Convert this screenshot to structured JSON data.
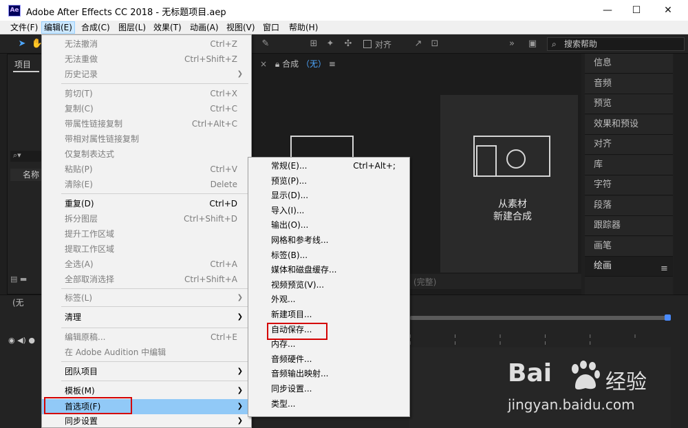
{
  "window": {
    "logo": "Ae",
    "title": "Adobe After Effects CC 2018 - 无标题项目.aep",
    "minimize": "—",
    "maximize": "☐",
    "close": "✕"
  },
  "menubar": [
    {
      "label": "文件(F)"
    },
    {
      "label": "编辑(E)",
      "active": true
    },
    {
      "label": "合成(C)"
    },
    {
      "label": "图层(L)"
    },
    {
      "label": "效果(T)"
    },
    {
      "label": "动画(A)"
    },
    {
      "label": "视图(V)"
    },
    {
      "label": "窗口"
    },
    {
      "label": "帮助(H)"
    }
  ],
  "toolbar": {
    "align_label": "对齐",
    "search_placeholder": "搜索帮助"
  },
  "project_panel": {
    "tab": "项目",
    "search_icon": "⌕▾",
    "name_col": "名称"
  },
  "viewer": {
    "tab_close": "×",
    "lock_icon": "lock-icon",
    "tab_label": "合成",
    "tab_value": "（无）",
    "menu_icon": "≡",
    "new_comp_line1": "从素材",
    "new_comp_line2": "新建合成",
    "resolution": "(完整)"
  },
  "right_panel": {
    "items": [
      "信息",
      "音频",
      "预览",
      "效果和预设",
      "对齐",
      "库",
      "字符",
      "段落",
      "跟踪器",
      "画笔",
      "绘画"
    ],
    "selected": "绘画",
    "menu_icon": "≡"
  },
  "timeline": {
    "tab": "(无",
    "ticks": "ı ı ı ı ı ı ı ı ı ı ı"
  },
  "edit_menu": {
    "items": [
      {
        "label": "无法撤消",
        "shortcut": "Ctrl+Z",
        "disabled": true
      },
      {
        "label": "无法重做",
        "shortcut": "Ctrl+Shift+Z",
        "disabled": true
      },
      {
        "label": "历史记录",
        "submenu": true,
        "disabled": true
      },
      {
        "label": "剪切(T)",
        "shortcut": "Ctrl+X",
        "disabled": true
      },
      {
        "label": "复制(C)",
        "shortcut": "Ctrl+C",
        "disabled": true
      },
      {
        "label": "带属性链接复制",
        "shortcut": "Ctrl+Alt+C",
        "disabled": true
      },
      {
        "label": "带相对属性链接复制",
        "disabled": true
      },
      {
        "label": "仅复制表达式",
        "disabled": true
      },
      {
        "label": "粘贴(P)",
        "shortcut": "Ctrl+V",
        "disabled": true
      },
      {
        "label": "清除(E)",
        "shortcut": "Delete",
        "disabled": true
      },
      {
        "label": "重复(D)",
        "shortcut": "Ctrl+D",
        "disabled": false
      },
      {
        "label": "拆分图层",
        "shortcut": "Ctrl+Shift+D",
        "disabled": true
      },
      {
        "label": "提升工作区域",
        "disabled": true
      },
      {
        "label": "提取工作区域",
        "disabled": true
      },
      {
        "label": "全选(A)",
        "shortcut": "Ctrl+A",
        "disabled": true
      },
      {
        "label": "全部取消选择",
        "shortcut": "Ctrl+Shift+A",
        "disabled": true
      },
      {
        "label": "标签(L)",
        "submenu": true,
        "disabled": true
      },
      {
        "label": "清理",
        "submenu": true,
        "disabled": false
      },
      {
        "label": "编辑原稿...",
        "shortcut": "Ctrl+E",
        "disabled": true
      },
      {
        "label": "在 Adobe Audition 中编辑",
        "disabled": true
      },
      {
        "label": "团队项目",
        "submenu": true,
        "disabled": false
      },
      {
        "label": "模板(M)",
        "submenu": true,
        "disabled": false
      },
      {
        "label": "首选项(F)",
        "submenu": true,
        "disabled": false,
        "highlighted": true
      },
      {
        "label": "同步设置",
        "submenu": true,
        "disabled": false
      }
    ]
  },
  "prefs_submenu": {
    "items": [
      {
        "label": "常规(E)...",
        "shortcut": "Ctrl+Alt+;"
      },
      {
        "label": "预览(P)..."
      },
      {
        "label": "显示(D)..."
      },
      {
        "label": "导入(I)..."
      },
      {
        "label": "输出(O)..."
      },
      {
        "label": "网格和参考线..."
      },
      {
        "label": "标签(B)..."
      },
      {
        "label": "媒体和磁盘缓存..."
      },
      {
        "label": "视频预览(V)..."
      },
      {
        "label": "外观..."
      },
      {
        "label": "新建项目..."
      },
      {
        "label": "自动保存...",
        "boxed": true
      },
      {
        "label": "内存..."
      },
      {
        "label": "音频硬件..."
      },
      {
        "label": "音频输出映射..."
      },
      {
        "label": "同步设置..."
      },
      {
        "label": "类型..."
      }
    ]
  },
  "watermark": {
    "logo": "Bai",
    "logo_cn": "经验",
    "url": "jingyan.baidu.com"
  }
}
